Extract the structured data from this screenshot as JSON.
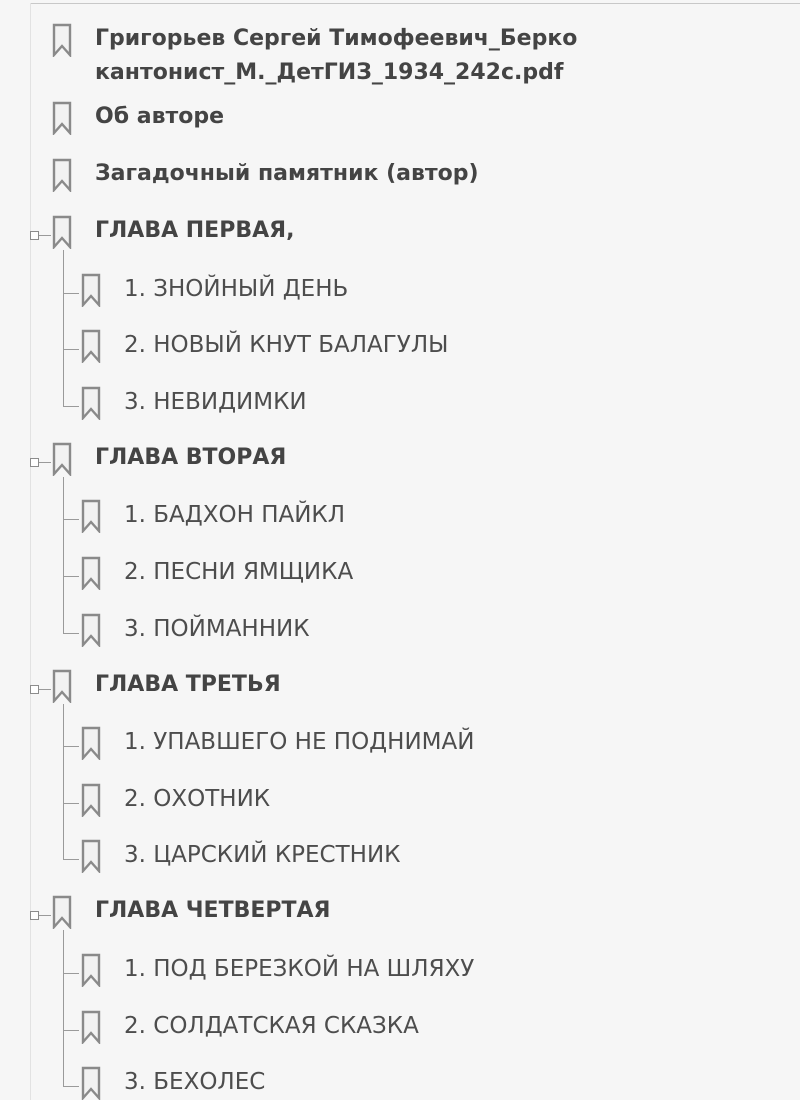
{
  "panel": {
    "items": [
      {
        "label": "Григорьев Сергей Тимофеевич_Берко",
        "label_line2": "кантонист_М._ДетГИЗ_1934_242c.pdf",
        "bold": true
      },
      {
        "label": "Об авторе",
        "bold": true
      },
      {
        "label": "Загадочный памятник (автор)",
        "bold": true
      },
      {
        "label": "ГЛАВА ПЕРВАЯ,",
        "bold": true,
        "expanded": true,
        "children": [
          {
            "label": "1. ЗНОЙНЫЙ ДЕНЬ"
          },
          {
            "label": "2. НОВЫЙ КНУТ БАЛАГУЛЫ"
          },
          {
            "label": "3. НЕВИДИМКИ"
          }
        ]
      },
      {
        "label": "ГЛАВА ВТОРАЯ",
        "bold": true,
        "expanded": true,
        "children": [
          {
            "label": "1. БАДХОН ПАЙКЛ"
          },
          {
            "label": "2. ПЕСНИ ЯМЩИКА"
          },
          {
            "label": "3. ПОЙМАННИК"
          }
        ]
      },
      {
        "label": "ГЛАВА ТРЕТЬЯ",
        "bold": true,
        "expanded": true,
        "children": [
          {
            "label": "1. УПАВШЕГО НЕ ПОДНИМАЙ"
          },
          {
            "label": "2. ОХОТНИК"
          },
          {
            "label": "3. ЦАРСКИЙ КРЕСТНИК"
          }
        ]
      },
      {
        "label": "ГЛАВА ЧЕТВЕРТАЯ",
        "bold": true,
        "expanded": true,
        "children": [
          {
            "label": "1. ПОД БЕРЕЗКОЙ НА ШЛЯХУ"
          },
          {
            "label": "2. СОЛДАТСКАЯ СКАЗКА"
          },
          {
            "label": "3. БЕХОЛЕС"
          }
        ]
      }
    ]
  },
  "icons": {
    "bookmark": "bookmark-icon",
    "toggle": "collapse-toggle-icon"
  },
  "colors": {
    "background": "#f6f6f6",
    "text": "#444444",
    "icon_stroke": "#8a8a8a",
    "tree_lines": "#9a9a9a"
  }
}
